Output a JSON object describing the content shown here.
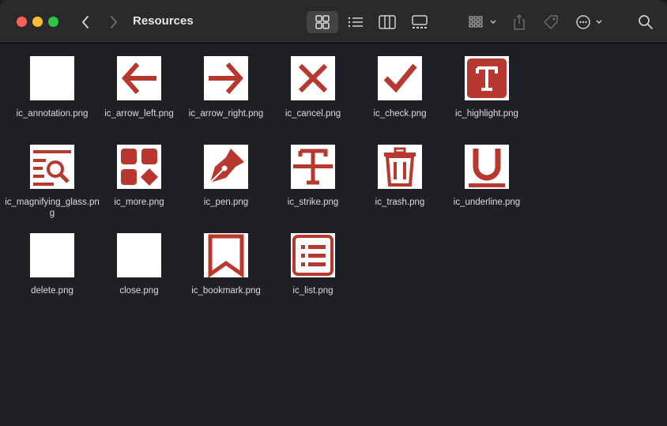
{
  "window": {
    "title": "Resources"
  },
  "toolbar": {
    "back_icon": "chevron-left-icon",
    "forward_icon": "chevron-right-icon",
    "views": [
      "icon-view",
      "list-view",
      "column-view",
      "gallery-view"
    ],
    "selected_view": "icon-view"
  },
  "files": [
    {
      "name": "ic_annotation.png",
      "icon": "blank"
    },
    {
      "name": "ic_arrow_left.png",
      "icon": "arrow-left"
    },
    {
      "name": "ic_arrow_right.png",
      "icon": "arrow-right"
    },
    {
      "name": "ic_cancel.png",
      "icon": "cancel"
    },
    {
      "name": "ic_check.png",
      "icon": "check"
    },
    {
      "name": "ic_highlight.png",
      "icon": "highlight"
    },
    {
      "name": "ic_magnifying_glass.png",
      "icon": "magnifying-glass"
    },
    {
      "name": "ic_more.png",
      "icon": "more"
    },
    {
      "name": "ic_pen.png",
      "icon": "pen"
    },
    {
      "name": "ic_strike.png",
      "icon": "strike"
    },
    {
      "name": "ic_trash.png",
      "icon": "trash"
    },
    {
      "name": "ic_underline.png",
      "icon": "underline"
    },
    {
      "name": "delete.png",
      "icon": "blank"
    },
    {
      "name": "close.png",
      "icon": "blank"
    },
    {
      "name": "ic_bookmark.png",
      "icon": "bookmark"
    },
    {
      "name": "ic_list.png",
      "icon": "list"
    }
  ],
  "colors": {
    "icon_red": "#b8372f",
    "window_bg": "#1e2025",
    "toolbar_bg": "#2a2a2c"
  }
}
